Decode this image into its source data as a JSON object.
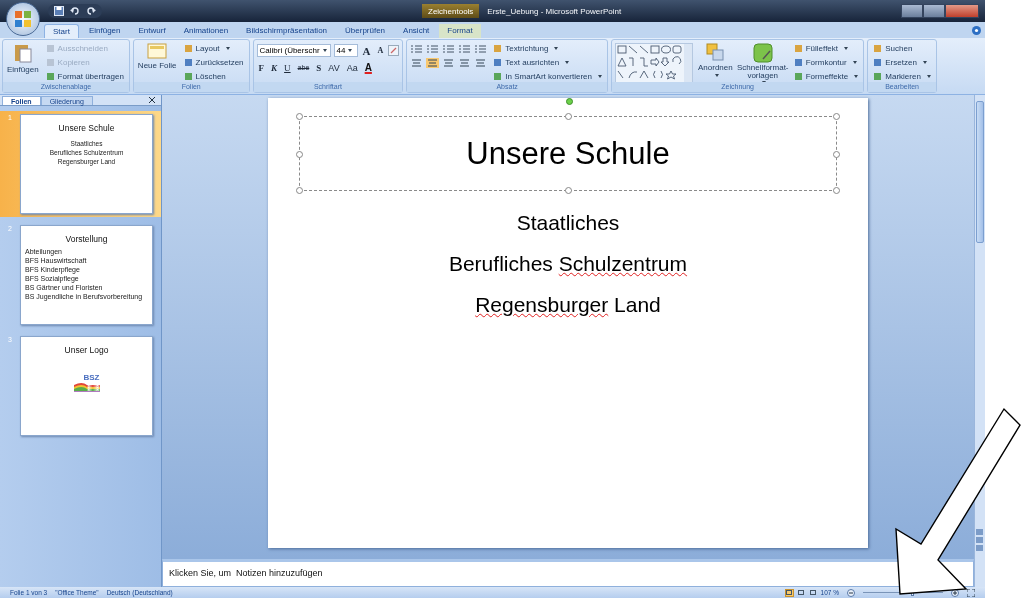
{
  "window": {
    "title": "Erste_Uebung - Microsoft PowerPoint",
    "context_tab": "Zeichentools"
  },
  "tabs": [
    {
      "label": "Start",
      "selected": true,
      "contextual": false
    },
    {
      "label": "Einfügen",
      "selected": false,
      "contextual": false
    },
    {
      "label": "Entwurf",
      "selected": false,
      "contextual": false
    },
    {
      "label": "Animationen",
      "selected": false,
      "contextual": false
    },
    {
      "label": "Bildschirmpräsentation",
      "selected": false,
      "contextual": false
    },
    {
      "label": "Überprüfen",
      "selected": false,
      "contextual": false
    },
    {
      "label": "Ansicht",
      "selected": false,
      "contextual": false
    },
    {
      "label": "Format",
      "selected": false,
      "contextual": true
    }
  ],
  "ribbon": {
    "groups": [
      {
        "kind": "clipboard",
        "label": "Zwischenablage",
        "large": [
          "Einfügen"
        ],
        "small": [
          {
            "label": "Ausschneiden",
            "disabled": true,
            "dropdown": false
          },
          {
            "label": "Kopieren",
            "disabled": true,
            "dropdown": false
          },
          {
            "label": "Format übertragen",
            "disabled": false,
            "dropdown": false
          }
        ]
      },
      {
        "kind": "slides",
        "label": "Folien",
        "large": [
          "Neue Folie"
        ],
        "small": [
          {
            "label": "Layout",
            "disabled": false,
            "dropdown": true
          },
          {
            "label": "Zurücksetzen",
            "disabled": false,
            "dropdown": false
          },
          {
            "label": "Löschen",
            "disabled": false,
            "dropdown": false
          }
        ]
      },
      {
        "kind": "font",
        "label": "Schriftart",
        "font": "Calibri (Überschr",
        "size": "44",
        "size_buttons": [
          "A",
          "A"
        ],
        "format_buttons": [
          "F",
          "K",
          "U",
          "abe",
          "S",
          "AV",
          "Aa",
          "A"
        ]
      },
      {
        "kind": "paragraph",
        "label": "Absatz",
        "small": [
          {
            "label": "Textrichtung",
            "disabled": false,
            "dropdown": true
          },
          {
            "label": "Text ausrichten",
            "disabled": false,
            "dropdown": true
          },
          {
            "label": "In SmartArt konvertieren",
            "disabled": false,
            "dropdown": true
          }
        ]
      },
      {
        "kind": "drawing",
        "label": "Zeichnung",
        "large": [
          "Anordnen",
          "Schnellformat-vorlagen"
        ],
        "small": [
          {
            "label": "Fülleffekt",
            "disabled": false,
            "dropdown": true
          },
          {
            "label": "Formkontur",
            "disabled": false,
            "dropdown": true
          },
          {
            "label": "Formeffekte",
            "disabled": false,
            "dropdown": true
          }
        ]
      },
      {
        "kind": "editing",
        "label": "Bearbeiten",
        "small": [
          {
            "label": "Suchen",
            "disabled": false,
            "dropdown": false
          },
          {
            "label": "Ersetzen",
            "disabled": false,
            "dropdown": true
          },
          {
            "label": "Markieren",
            "disabled": false,
            "dropdown": true
          }
        ]
      }
    ]
  },
  "left_panel": {
    "tabs": [
      {
        "label": "Folien",
        "selected": true
      },
      {
        "label": "Gliederung",
        "selected": false
      }
    ],
    "slides": [
      {
        "kind": "text",
        "number": "1",
        "selected": true,
        "title": "Unsere Schule",
        "lines": [
          "Staatliches",
          "Berufliches Schulzentrum",
          "Regensburger Land"
        ]
      },
      {
        "kind": "bullets",
        "number": "2",
        "selected": false,
        "title": "Vorstellung",
        "lines": [
          "Abteilungen",
          "BFS Hauswirtschaft",
          "BFS Kinderpflege",
          "BFS Sozialpflege",
          "BS Gärtner und Floristen",
          "BS Jugendliche  in Berufsvorbereitung"
        ]
      },
      {
        "kind": "logo",
        "number": "3",
        "selected": false,
        "title": "Unser Logo",
        "logo_text": "BSZ"
      }
    ]
  },
  "slide": {
    "title": "Unsere Schule",
    "title_selected": true,
    "lines": [
      [
        {
          "text": "Staatliches",
          "misspelled": false
        }
      ],
      [
        {
          "text": "Berufliches ",
          "misspelled": false
        },
        {
          "text": "Schulzentrum",
          "misspelled": true
        }
      ],
      [
        {
          "text": "Regensburger",
          "misspelled": true
        },
        {
          "text": " Land",
          "misspelled": false
        }
      ]
    ]
  },
  "notes": {
    "placeholder": "Klicken Sie, um  Notizen hinzuzufügen"
  },
  "status_bar": {
    "slide_info": "Folie 1 von 3",
    "theme": "\"Office Theme\"",
    "language": "Deutsch (Deutschland)",
    "views": [
      {
        "selected": true
      },
      {
        "selected": false
      },
      {
        "selected": false
      }
    ],
    "zoom": "107 %",
    "zoom_slider": {
      "level": 0.6
    }
  }
}
